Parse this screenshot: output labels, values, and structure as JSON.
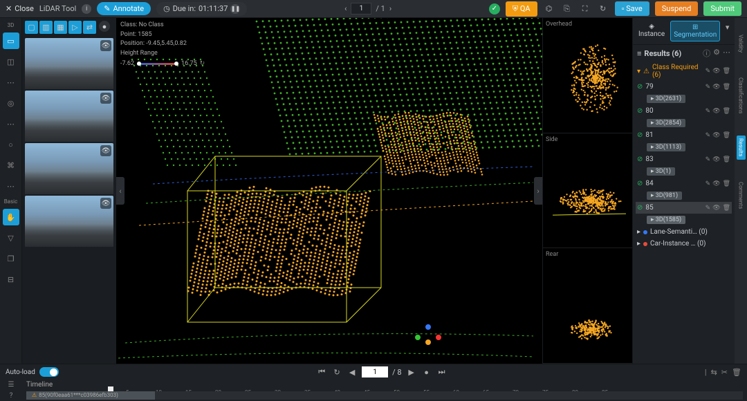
{
  "topbar": {
    "close": "Close",
    "tool": "LiDAR Tool",
    "annotate": "Annotate",
    "due_prefix": "Due in:",
    "due_time": "01:11:37",
    "page_current": "1",
    "page_total": "/ 1",
    "qa": "QA",
    "save": "Save",
    "suspend": "Suspend",
    "submit": "Submit"
  },
  "left_rail": {
    "l3d": "3D",
    "basic": "Basic"
  },
  "overlay": {
    "class_line": "Class: No Class",
    "point_line": "Point: 1585",
    "pos_line": "Position: -9.45,5.45,0.82",
    "height_label": "Height Range",
    "h_min": "-7.62",
    "h_max": "16.75"
  },
  "side_views": {
    "overhead": "Overhead",
    "side": "Side",
    "rear": "Rear"
  },
  "right": {
    "tab_instance": "Instance",
    "tab_segmentation": "Segmentation",
    "results_label": "Results (6)",
    "class_required": "Class Required  (6)",
    "items": [
      {
        "id": "79",
        "tag": "3D(2631)"
      },
      {
        "id": "80",
        "tag": "3D(2854)"
      },
      {
        "id": "81",
        "tag": "3D(1113)"
      },
      {
        "id": "83",
        "tag": "3D(1)"
      },
      {
        "id": "84",
        "tag": "3D(981)"
      },
      {
        "id": "85",
        "tag": "3D(1585)"
      }
    ],
    "lane": "Lane-Semanti…  (0)",
    "car": "Car-Instance …  (0)",
    "rail": {
      "validity": "Validity",
      "class": "Classifications",
      "results": "Results",
      "comments": "Comments"
    }
  },
  "bottom": {
    "auto_load": "Auto-load",
    "frame": "1",
    "frame_total": "/ 8",
    "timeline": "Timeline",
    "track_label": "85(90f0eaa61***c03986efb303)",
    "ticks": [
      "5",
      "10",
      "15",
      "20",
      "25",
      "30",
      "35",
      "40",
      "45",
      "50",
      "55",
      "60",
      "65",
      "70",
      "75",
      "80",
      "85"
    ]
  }
}
